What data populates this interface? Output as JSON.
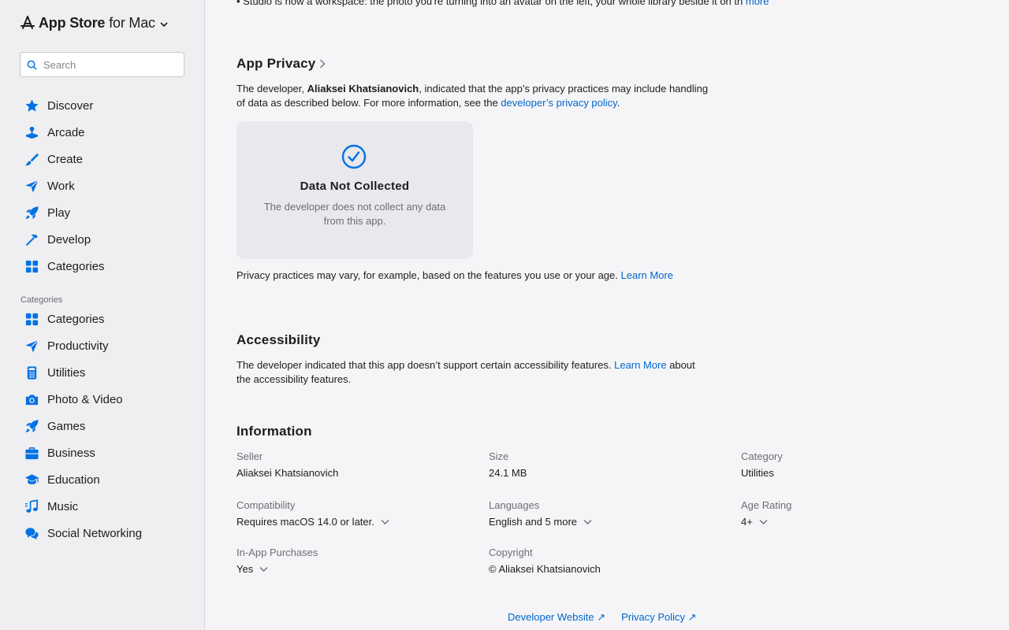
{
  "sidebar": {
    "brand": {
      "title": "App Store",
      "suffix": "for Mac"
    },
    "search": {
      "placeholder": "Search"
    },
    "nav": [
      {
        "label": "Discover",
        "icon": "star-icon"
      },
      {
        "label": "Arcade",
        "icon": "joystick-icon"
      },
      {
        "label": "Create",
        "icon": "paintbrush-icon"
      },
      {
        "label": "Work",
        "icon": "paperplane-icon"
      },
      {
        "label": "Play",
        "icon": "rocket-icon"
      },
      {
        "label": "Develop",
        "icon": "hammer-icon"
      },
      {
        "label": "Categories",
        "icon": "grid-icon"
      }
    ],
    "categories_heading": "Categories",
    "categories": [
      {
        "label": "Categories",
        "icon": "grid-icon"
      },
      {
        "label": "Productivity",
        "icon": "paperplane-icon"
      },
      {
        "label": "Utilities",
        "icon": "calculator-icon"
      },
      {
        "label": "Photo & Video",
        "icon": "camera-icon"
      },
      {
        "label": "Games",
        "icon": "rocket-icon"
      },
      {
        "label": "Business",
        "icon": "briefcase-icon"
      },
      {
        "label": "Education",
        "icon": "graduationcap-icon"
      },
      {
        "label": "Music",
        "icon": "music-note-icon"
      },
      {
        "label": "Social Networking",
        "icon": "chat-bubbles-icon"
      }
    ]
  },
  "main": {
    "top_text": "• Studio is now a workspace: the photo you're turning into an avatar on the left, your whole library beside it on th",
    "top_more": "more",
    "privacy": {
      "title": "App Privacy",
      "intro_1": "The developer, ",
      "developer": "Aliaksei Khatsianovich",
      "intro_2": ", indicated that the app’s privacy practices may include handling of data as described below. For more information, see the ",
      "policy_link": "developer’s privacy policy",
      "intro_3": ".",
      "card_title": "Data Not Collected",
      "card_desc": "The developer does not collect any data from this app.",
      "note": "Privacy practices may vary, for example, based on the features you use or your age. ",
      "learn_more": "Learn More"
    },
    "accessibility": {
      "title": "Accessibility",
      "text_1": "The developer indicated that this app doesn’t support certain accessibility features. ",
      "learn_more": "Learn More",
      "text_2": " about the accessibility features."
    },
    "information": {
      "title": "Information",
      "seller_label": "Seller",
      "seller": "Aliaksei Khatsianovich",
      "size_label": "Size",
      "size": "24.1 MB",
      "category_label": "Category",
      "category": "Utilities",
      "compat_label": "Compatibility",
      "compat": "Requires macOS 14.0 or later.",
      "lang_label": "Languages",
      "lang": "English and 5 more",
      "age_label": "Age Rating",
      "age": "4+",
      "iap_label": "In-App Purchases",
      "iap": "Yes",
      "copyright_label": "Copyright",
      "copyright": "© Aliaksei Khatsianovich"
    },
    "footer": {
      "developer_website": "Developer Website ↗",
      "privacy_policy": "Privacy Policy ↗"
    }
  },
  "colors": {
    "accent": "#0071e3",
    "link": "#0066cc",
    "sidebar_bg": "#efeff1",
    "card_bg": "#e8e8ed"
  }
}
